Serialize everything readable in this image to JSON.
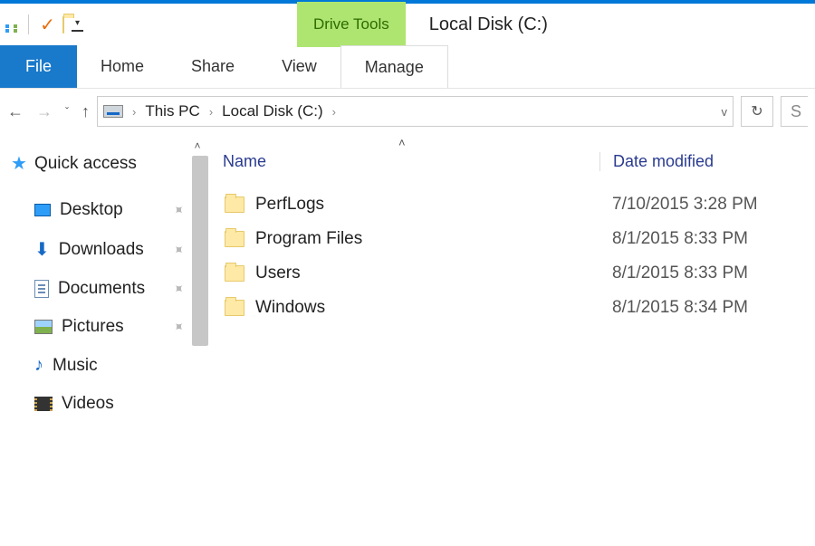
{
  "title": "Local Disk (C:)",
  "drive_tools_label": "Drive Tools",
  "ribbon": {
    "file": "File",
    "tabs": [
      "Home",
      "Share",
      "View",
      "Manage"
    ]
  },
  "breadcrumb": [
    "This PC",
    "Local Disk (C:)"
  ],
  "search_placeholder": "S",
  "sidebar": {
    "quick_access": "Quick access",
    "items": [
      {
        "label": "Desktop",
        "pinned": true
      },
      {
        "label": "Downloads",
        "pinned": true
      },
      {
        "label": "Documents",
        "pinned": true
      },
      {
        "label": "Pictures",
        "pinned": true
      },
      {
        "label": "Music",
        "pinned": false
      },
      {
        "label": "Videos",
        "pinned": false
      }
    ]
  },
  "columns": {
    "name": "Name",
    "date": "Date modified"
  },
  "rows": [
    {
      "name": "PerfLogs",
      "date": "7/10/2015 3:28 PM"
    },
    {
      "name": "Program Files",
      "date": "8/1/2015 8:33 PM"
    },
    {
      "name": "Users",
      "date": "8/1/2015 8:33 PM"
    },
    {
      "name": "Windows",
      "date": "8/1/2015 8:34 PM"
    }
  ]
}
